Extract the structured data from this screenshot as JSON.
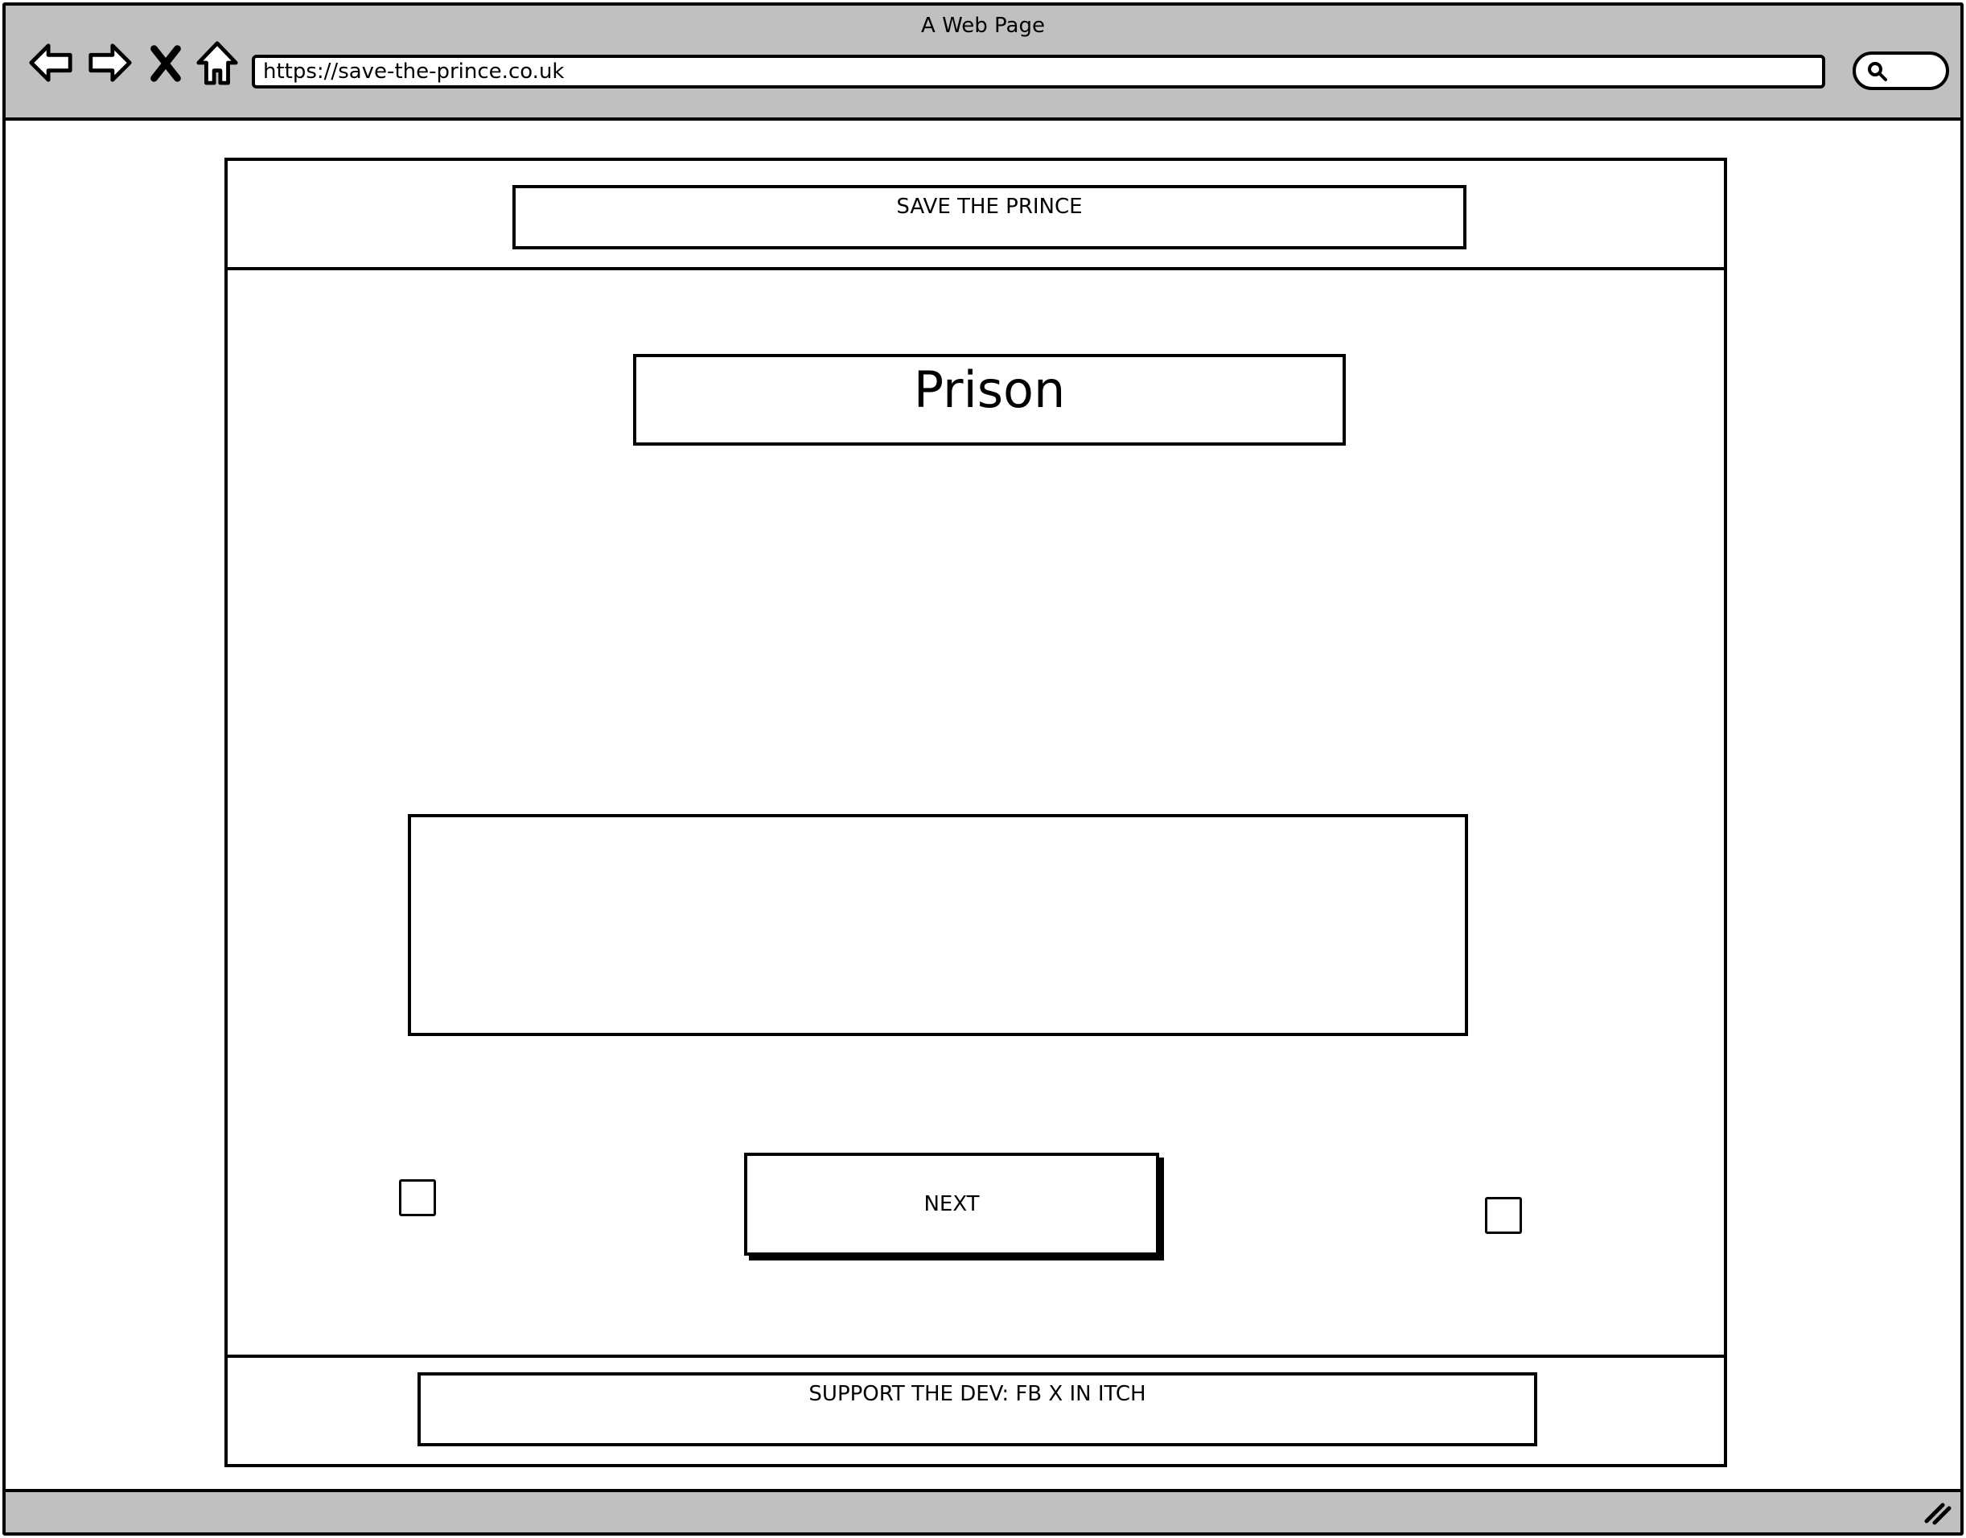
{
  "browser": {
    "window_title": "A Web Page",
    "url": "https://save-the-prince.co.uk",
    "toolbar_color": "#c0c0c0"
  },
  "icons": {
    "back": "back-arrow-icon",
    "forward": "forward-arrow-icon",
    "stop": "close-icon",
    "home": "home-icon",
    "search": "search-icon",
    "resize": "resize-grip-icon"
  },
  "page": {
    "header": "SAVE THE PRINCE",
    "title": "Prison",
    "next_button": "NEXT",
    "footer": "SUPPORT THE DEV: FB X IN ITCH"
  }
}
